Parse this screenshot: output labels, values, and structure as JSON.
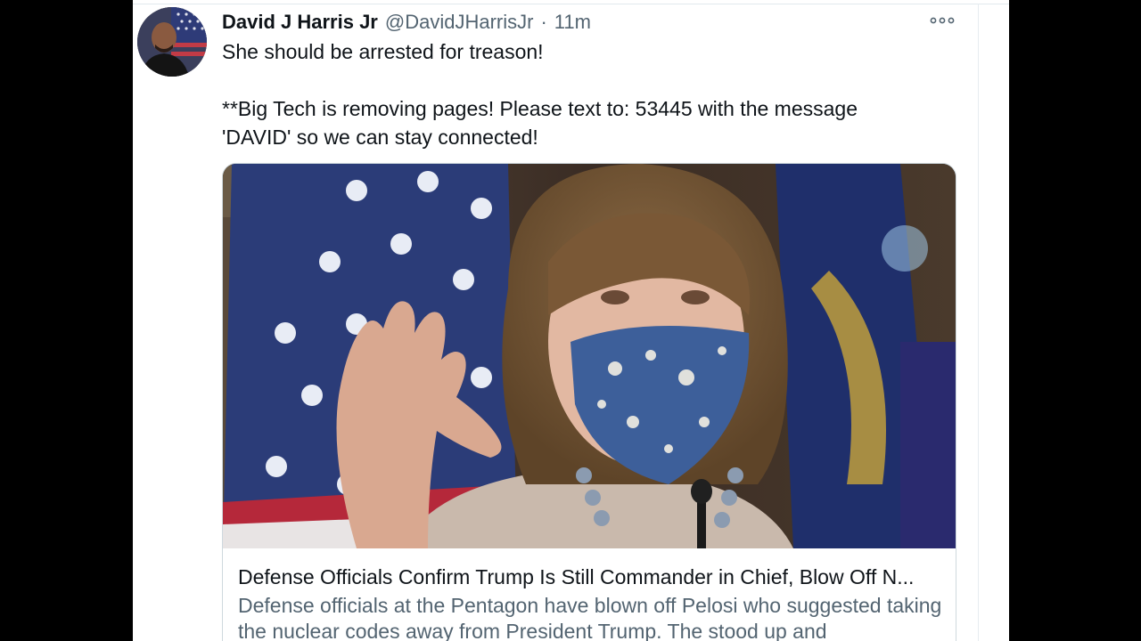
{
  "tweet": {
    "author_name": "David J Harris Jr",
    "handle": "@DavidJHarrisJr",
    "separator": "·",
    "time": "11m",
    "more_icon": "more-horizontal-icon",
    "text_line1": "She should be arrested for treason!",
    "text_line2": "**Big Tech is removing pages! Please text to: 53445 with the message",
    "text_line3": "'DAVID' so we can stay connected!"
  },
  "card": {
    "title": "Defense Officials Confirm Trump Is Still Commander in Chief, Blow Off N...",
    "description": "Defense officials at the Pentagon have blown off Pelosi who suggested taking the nuclear codes away from President Trump. The stood up and"
  },
  "colors": {
    "text_primary": "#0f1419",
    "text_secondary": "#536471",
    "border": "#cfd9de",
    "flag_blue": "#2b3c78",
    "flag_red": "#b5283a"
  }
}
